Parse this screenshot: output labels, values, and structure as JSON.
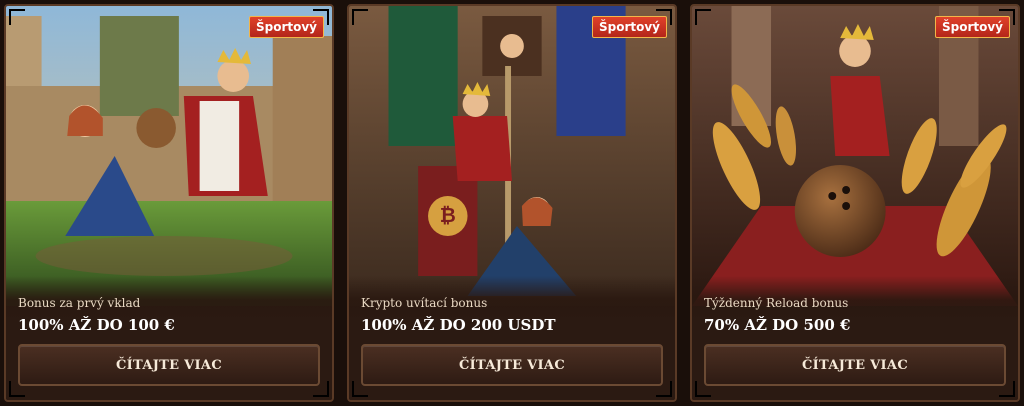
{
  "promotions": [
    {
      "badge": "Športový",
      "subtitle": "Bonus za prvý vklad",
      "headline": "100% AŽ DO 100 €",
      "button_label": "ČÍTAJTE VIAC",
      "art_icon": "castle-football-art"
    },
    {
      "badge": "Športový",
      "subtitle": "Krypto uvítací bonus",
      "headline": "100% AŽ DO 200 USDT",
      "button_label": "ČÍTAJTE VIAC",
      "art_icon": "crypto-castle-art"
    },
    {
      "badge": "Športový",
      "subtitle": "Týždenný Reload bonus",
      "headline": "70% AŽ DO 500 €",
      "button_label": "ČÍTAJTE VIAC",
      "art_icon": "bowling-art"
    }
  ],
  "colors": {
    "badge_bg": "#c8321f",
    "button_border": "#6b4a33",
    "card_bg": "#2a1810",
    "frame_gold": "#b08552"
  }
}
